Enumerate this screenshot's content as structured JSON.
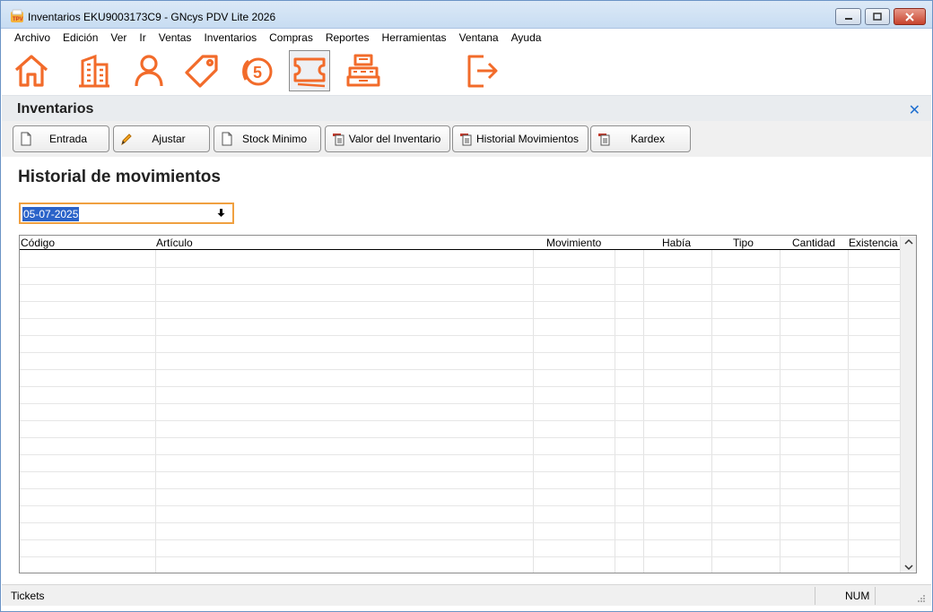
{
  "window": {
    "title": "Inventarios EKU9003173C9 - GNcys PDV Lite 2026"
  },
  "menu": [
    "Archivo",
    "Edición",
    "Ver",
    "Ir",
    "Ventas",
    "Inventarios",
    "Compras",
    "Reportes",
    "Herramientas",
    "Ventana",
    "Ayuda"
  ],
  "toolbar_icons": [
    {
      "name": "home-icon"
    },
    {
      "name": "building-icon"
    },
    {
      "name": "user-icon"
    },
    {
      "name": "tag-icon"
    },
    {
      "name": "coin-5-icon"
    },
    {
      "name": "tickets-icon",
      "active": true
    },
    {
      "name": "cash-register-icon"
    },
    {
      "name": "exit-icon"
    }
  ],
  "accent_color": "#f26b2a",
  "panel": {
    "title": "Inventarios",
    "close_glyph": "✕"
  },
  "actions": [
    {
      "label": "Entrada",
      "icon": "document-icon"
    },
    {
      "label": "Ajustar",
      "icon": "pencil-icon"
    },
    {
      "label": "Stock Minimo",
      "icon": "document-icon"
    },
    {
      "label": "Valor del Inventario",
      "icon": "report-icon"
    },
    {
      "label": "Historial Movimientos",
      "icon": "report-icon"
    },
    {
      "label": "Kardex",
      "icon": "report-icon"
    }
  ],
  "section": {
    "title": "Historial de movimientos"
  },
  "date_filter": {
    "value": "05-07-2025"
  },
  "table": {
    "columns": [
      "Código",
      "Artículo",
      "Movimiento",
      "",
      "Había",
      "Tipo",
      "Cantidad",
      "Existencia"
    ],
    "rows": []
  },
  "status": {
    "left": "Tickets",
    "num": "NUM"
  }
}
